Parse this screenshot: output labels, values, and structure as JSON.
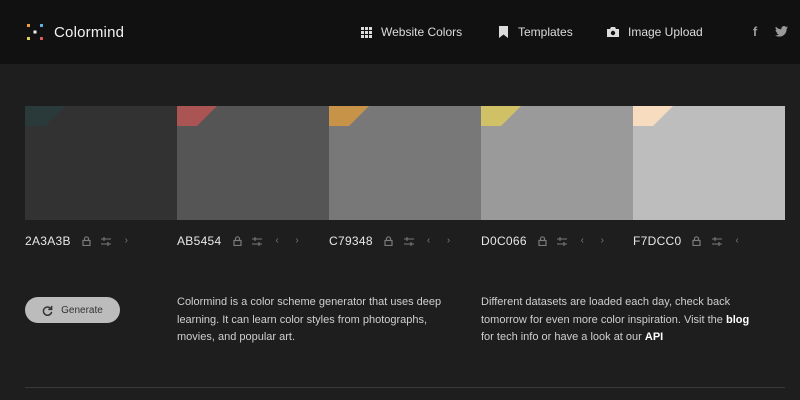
{
  "header": {
    "brand": "Colormind",
    "nav": [
      {
        "label": "Website Colors",
        "icon": "grid-icon"
      },
      {
        "label": "Templates",
        "icon": "bookmark-icon"
      },
      {
        "label": "Image Upload",
        "icon": "camera-icon"
      }
    ],
    "social": {
      "facebook": "f",
      "twitter": "twitter-icon"
    }
  },
  "palette": [
    {
      "code": "2A3A3B",
      "accent": "#2A3A3B",
      "fill": "#323232",
      "arrows": "right"
    },
    {
      "code": "AB5454",
      "accent": "#AB5454",
      "fill": "#555555",
      "arrows": "both"
    },
    {
      "code": "C79348",
      "accent": "#C79348",
      "fill": "#787878",
      "arrows": "both"
    },
    {
      "code": "D0C066",
      "accent": "#D0C066",
      "fill": "#9a9a9a",
      "arrows": "both"
    },
    {
      "code": "F7DCC0",
      "accent": "#F7DCC0",
      "fill": "#bdbdbd",
      "arrows": "left"
    }
  ],
  "actions": {
    "generate": "Generate"
  },
  "info": {
    "left": "Colormind is a color scheme generator that uses deep learning. It can learn color styles from photographs, movies, and popular art.",
    "right_before_blog": "Different datasets are loaded each day, check back tomorrow for even more color inspiration. Visit the ",
    "blog_link": "blog",
    "right_middle": " for tech info or have a look at our ",
    "api_link": "API"
  },
  "colors": {
    "background": "#1e1e1e",
    "header": "#111111",
    "button": "#bcbcbc"
  }
}
